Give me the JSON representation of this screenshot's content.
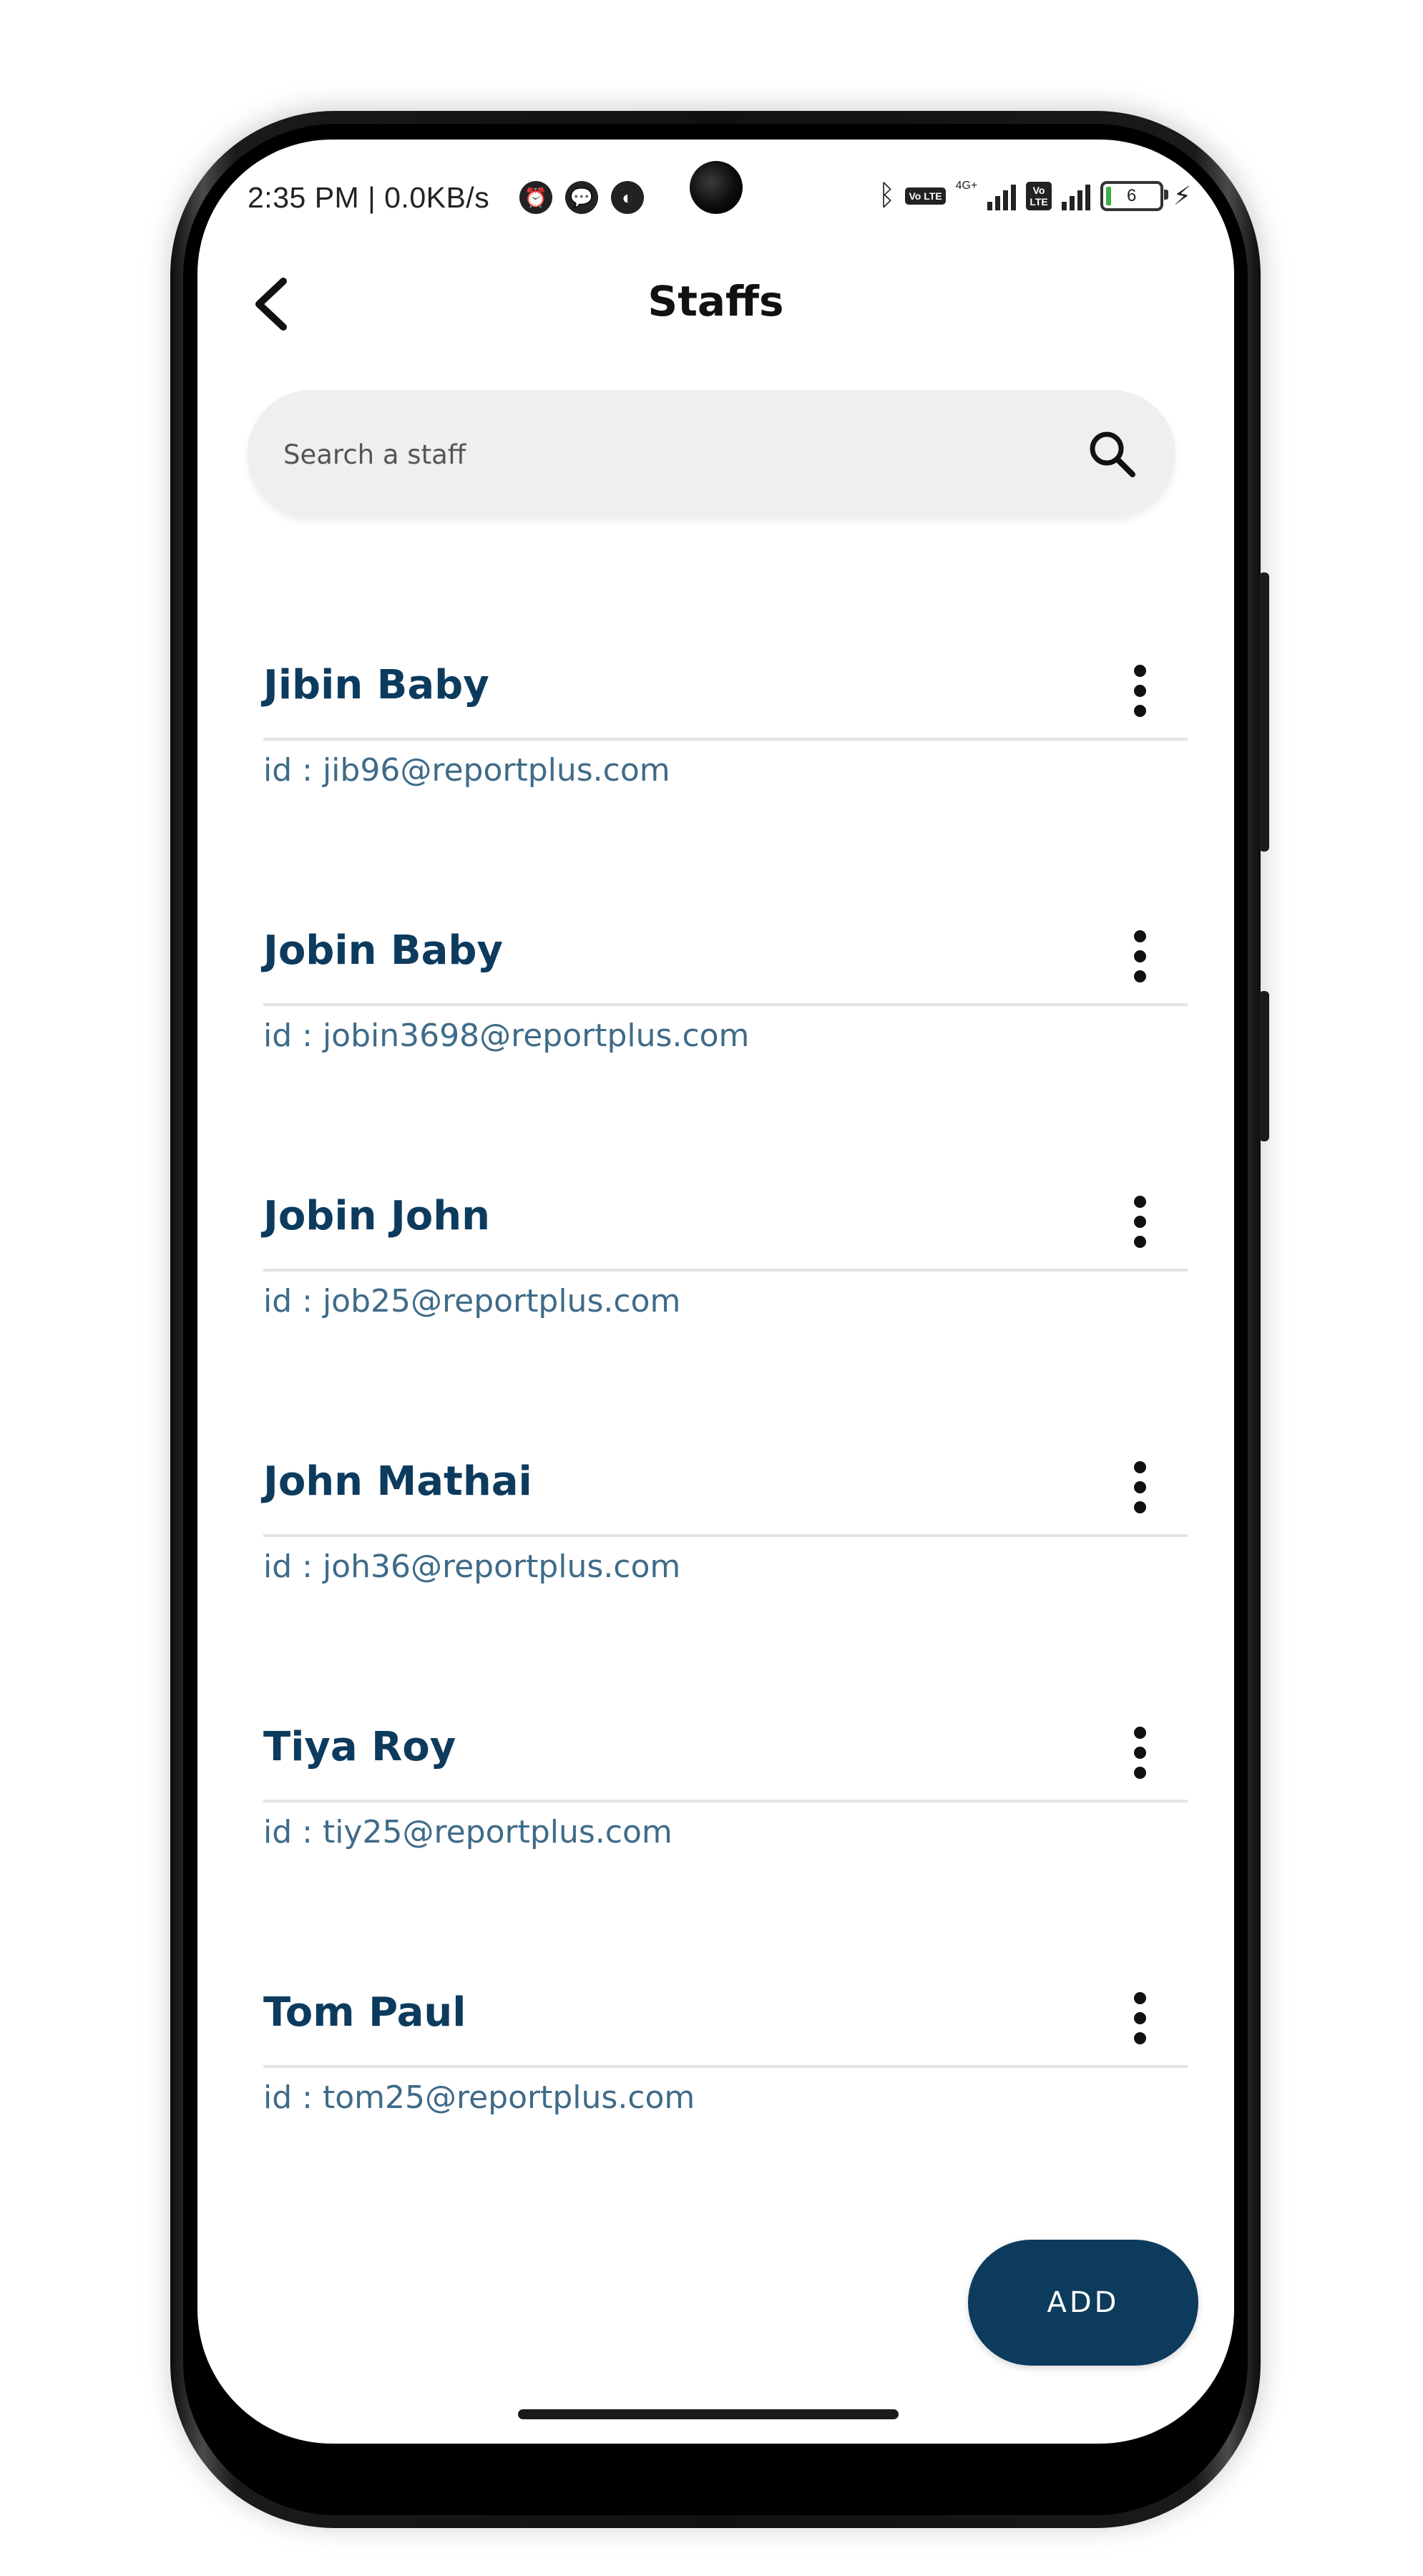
{
  "status_bar": {
    "time": "2:35 PM | 0.0KB/s",
    "battery": "6",
    "network": "4G+",
    "volte_label": "Vo LTE"
  },
  "header": {
    "title": "Staffs"
  },
  "search": {
    "placeholder": "Search a staff"
  },
  "staff": [
    {
      "name": "Jibin Baby",
      "id": "id : jib96@reportplus.com"
    },
    {
      "name": "Jobin Baby",
      "id": "id : jobin3698@reportplus.com"
    },
    {
      "name": "Jobin John",
      "id": "id : job25@reportplus.com"
    },
    {
      "name": "John Mathai",
      "id": "id : joh36@reportplus.com"
    },
    {
      "name": "Tiya Roy",
      "id": "id : tiy25@reportplus.com"
    },
    {
      "name": "Tom Paul",
      "id": "id : tom25@reportplus.com"
    }
  ],
  "add_button": {
    "label": "ADD"
  },
  "colors": {
    "primary": "#0d3b5e",
    "id_text": "#3f6b88",
    "search_bg": "#efefef"
  },
  "icons": [
    "back-arrow-icon",
    "search-icon",
    "more-vertical-icon",
    "alarm-icon",
    "chat-icon",
    "bluetooth-icon",
    "signal-icon",
    "battery-icon",
    "charging-icon"
  ]
}
